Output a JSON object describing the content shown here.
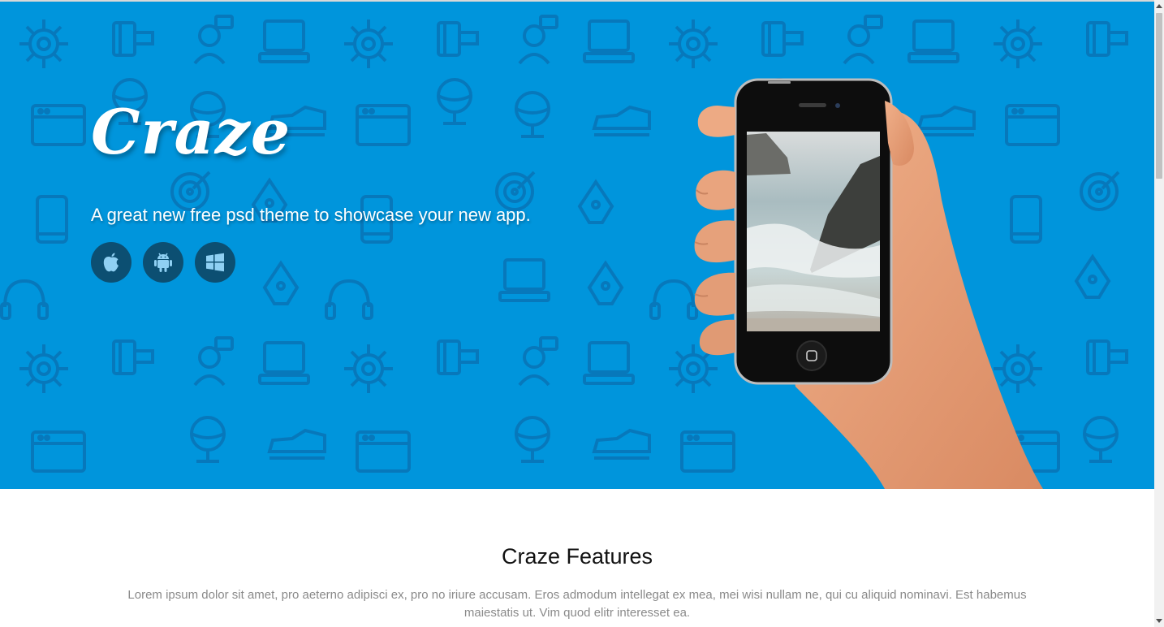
{
  "hero": {
    "brand": "Craze",
    "tagline": "A great new free psd theme to showcase your new app.",
    "store_buttons": [
      {
        "icon": "apple-icon"
      },
      {
        "icon": "android-icon"
      },
      {
        "icon": "windows-icon"
      }
    ]
  },
  "features": {
    "title": "Craze Features",
    "text": "Lorem ipsum dolor sit amet, pro aeterno adipisci ex, pro no iriure accusam. Eros admodum intellegat ex mea, mei wisi nullam ne, qui cu aliquid nominavi. Est habemus maiestatis ut. Vim quod elitr interesset ea."
  },
  "colors": {
    "hero_bg": "#0095dc",
    "pattern_line": "#0a6fb0",
    "button_bg": "#0c4f72"
  }
}
